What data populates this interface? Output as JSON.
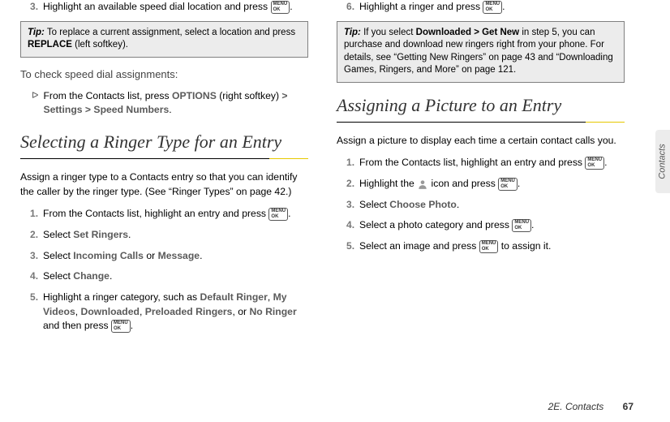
{
  "left": {
    "step3": "Highlight an available speed dial location and press",
    "tip1_label": "Tip:",
    "tip1_text_a": "To replace a current assignment, select a location and press ",
    "tip1_bold": "REPLACE",
    "tip1_text_b": " (left softkey).",
    "check_heading": "To check speed dial assignments:",
    "bullet_a": "From the Contacts list, press ",
    "bullet_b": "OPTIONS",
    "bullet_c": " (right softkey) ",
    "bullet_d": "> Settings > Speed Numbers",
    "bullet_e": ".",
    "section_title": "Selecting a Ringer Type for an Entry",
    "intro": "Assign a ringer type to a Contacts entry so that you can identify the caller by the ringer type. (See “Ringer Types” on page 42.)",
    "s1": "From the Contacts list, highlight an entry and press",
    "s2a": "Select ",
    "s2b": "Set Ringers",
    "s3a": "Select ",
    "s3b": "Incoming Calls",
    "s3c": " or ",
    "s3d": "Message",
    "s4a": "Select ",
    "s4b": "Change",
    "s5a": "Highlight a ringer category, such as ",
    "s5b": "Default Ringer",
    "s5c": ", ",
    "s5d": "My Videos",
    "s5e": ",  ",
    "s5f": "Downloaded",
    "s5g": ", ",
    "s5h": "Preloaded Ringers",
    "s5i": ", or ",
    "s5j": "No Ringer",
    "s5k": " and then press"
  },
  "right": {
    "s6": "Highlight a ringer and press",
    "tip2_label": "Tip:",
    "tip2_a": "If you select ",
    "tip2_b": "Downloaded > Get New",
    "tip2_c": " in step 5, you can purchase and download new ringers right from your phone. For details, see “Getting New Ringers” on page 43 and “Downloading Games, Ringers, and More” on page 121.",
    "section_title": "Assigning a Picture to an Entry",
    "intro": "Assign a picture to display each time a certain contact calls you.",
    "s1": "From the Contacts list, highlight an entry and press",
    "s2a": "Highlight the ",
    "s2b": " icon and press",
    "s3a": "Select ",
    "s3b": "Choose Photo",
    "s4": "Select a photo category and press",
    "s5a": "Select an image and press",
    "s5b": " to assign it."
  },
  "tab": "Contacts",
  "footer_section": "2E. Contacts",
  "footer_page": "67",
  "key_line1": "MENU",
  "key_line2": "OK"
}
